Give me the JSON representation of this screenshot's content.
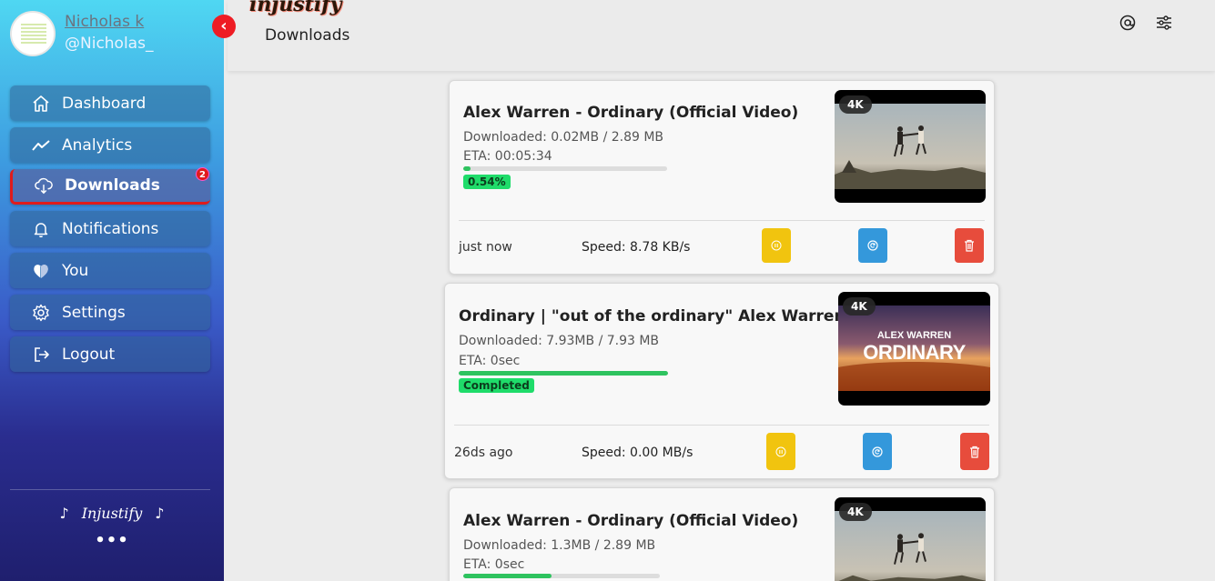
{
  "profile": {
    "name": "Nicholas k",
    "handle": "@Nicholas_"
  },
  "sidebar": {
    "items": [
      {
        "label": "Dashboard",
        "icon": "home-icon"
      },
      {
        "label": "Analytics",
        "icon": "chart-line-icon"
      },
      {
        "label": "Downloads",
        "icon": "cloud-download-icon",
        "badge": "2",
        "active": true
      },
      {
        "label": "Notifications",
        "icon": "bell-icon"
      },
      {
        "label": "You",
        "icon": "heart-shield-icon"
      },
      {
        "label": "Settings",
        "icon": "gear-icon"
      },
      {
        "label": "Logout",
        "icon": "logout-icon"
      }
    ],
    "brand": "Injustify",
    "more": "•••"
  },
  "header": {
    "logo": "injustify",
    "title": "Downloads"
  },
  "downloads": [
    {
      "title": "Alex Warren - Ordinary (Official Video)",
      "downloaded": "Downloaded: 0.02MB / 2.89 MB",
      "eta": "ETA: 00:05:34",
      "progress": 0.0054,
      "status": "0.54%",
      "quality": "4K",
      "time": "just now",
      "speed": "Speed: 8.78 KB/s"
    },
    {
      "title": "Ordinary | \"out of the ordinary\" Alex Warren",
      "downloaded": "Downloaded: 7.93MB / 7.93 MB",
      "eta": "ETA: 0sec",
      "progress": 1.0,
      "status": "Completed",
      "quality": "4K",
      "thumb_line1": "ALEX WARREN",
      "thumb_line2": "ORDINARY",
      "time": "26ds ago",
      "speed": "Speed: 0.00 MB/s"
    },
    {
      "title": "Alex Warren - Ordinary (Official Video)",
      "downloaded": "Downloaded: 1.3MB / 2.89 MB",
      "eta": "ETA: 0sec",
      "progress": 0.45,
      "quality": "4K"
    }
  ],
  "colors": {
    "accent_red": "#e01b1b",
    "progress_green": "#2ec35f",
    "pause_yellow": "#f1c40f",
    "retry_blue": "#3498db",
    "delete_red": "#e74c3c"
  }
}
